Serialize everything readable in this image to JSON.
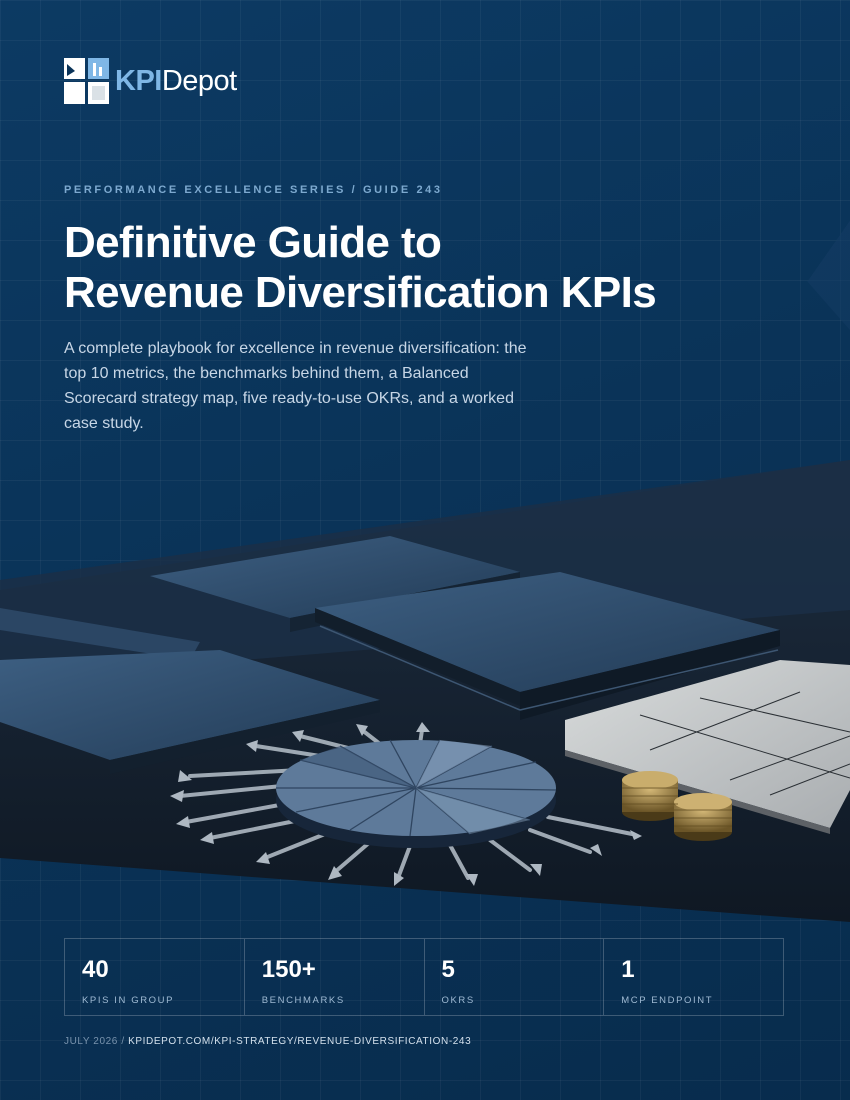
{
  "brand": {
    "logo_icon": "kpidepot-logo-icon",
    "name_part1": "KPI",
    "name_part2": "Depot",
    "accent_color": "#7fb7e6"
  },
  "cover": {
    "series": "PERFORMANCE EXCELLENCE SERIES / GUIDE 243",
    "title_line1": "Definitive Guide to",
    "title_line2": "Revenue Diversification KPIs",
    "subtitle": "A complete playbook for excellence in revenue diversification: the top 10 metrics, the benchmarks behind them, a Balanced Scorecard strategy map, five ready-to-use OKRs, and a worked case study.",
    "background_color": "#0a3358"
  },
  "hero_image": {
    "icon": "desk-pie-chart-illustration"
  },
  "stats": [
    {
      "value": "40",
      "label": "KPIS IN GROUP"
    },
    {
      "value": "150+",
      "label": "BENCHMARKS"
    },
    {
      "value": "5",
      "label": "OKRS"
    },
    {
      "value": "1",
      "label": "MCP ENDPOINT"
    }
  ],
  "footer": {
    "date": "JULY 2026 / ",
    "url": "KPIDEPOT.COM/KPI-STRATEGY/REVENUE-DIVERSIFICATION-243"
  }
}
